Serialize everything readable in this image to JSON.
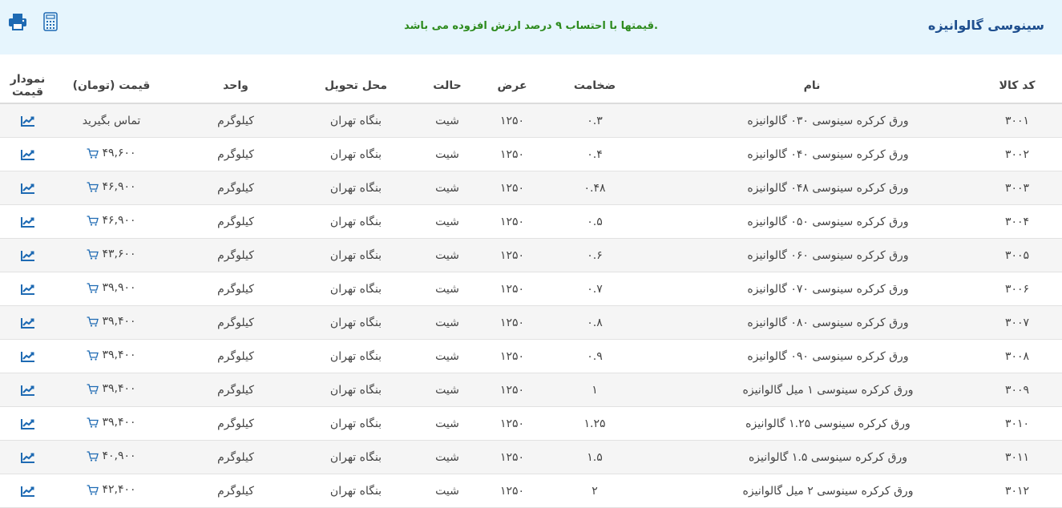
{
  "header": {
    "title": "سینوسی گالوانیزه",
    "vat_notice": "قیمتها با احتساب ۹ درصد ارزش افزوده می باشد.",
    "icons": [
      "print-icon",
      "calculator-icon"
    ]
  },
  "colors": {
    "accent": "#1f4f8f",
    "notice": "#2c8a1c",
    "header_bg": "#e6f5fd",
    "icon": "#1e6ab3"
  },
  "table": {
    "columns": {
      "code": "کد کالا",
      "name": "نام",
      "thickness": "ضخامت",
      "width": "عرض",
      "state": "حالت",
      "place": "محل تحویل",
      "unit": "واحد",
      "price": "قیمت (تومان)",
      "chart": "نمودار قیمت"
    },
    "rows": [
      {
        "code": "۳۰۰۱",
        "name": "ورق کرکره سینوسی ۰۳۰ گالوانیزه",
        "thickness": "۰.۳",
        "width": "۱۲۵۰",
        "state": "شیت",
        "place": "بنگاه تهران",
        "unit": "کیلوگرم",
        "price": "تماس بگیرید",
        "cart": false
      },
      {
        "code": "۳۰۰۲",
        "name": "ورق کرکره سینوسی ۰۴۰ گالوانیزه",
        "thickness": "۰.۴",
        "width": "۱۲۵۰",
        "state": "شیت",
        "place": "بنگاه تهران",
        "unit": "کیلوگرم",
        "price": "۴۹,۶۰۰",
        "cart": true
      },
      {
        "code": "۳۰۰۳",
        "name": "ورق کرکره سینوسی ۰۴۸ گالوانیزه",
        "thickness": "۰.۴۸",
        "width": "۱۲۵۰",
        "state": "شیت",
        "place": "بنگاه تهران",
        "unit": "کیلوگرم",
        "price": "۴۶,۹۰۰",
        "cart": true
      },
      {
        "code": "۳۰۰۴",
        "name": "ورق کرکره سینوسی ۰۵۰ گالوانیزه",
        "thickness": "۰.۵",
        "width": "۱۲۵۰",
        "state": "شیت",
        "place": "بنگاه تهران",
        "unit": "کیلوگرم",
        "price": "۴۶,۹۰۰",
        "cart": true
      },
      {
        "code": "۳۰۰۵",
        "name": "ورق کرکره سینوسی ۰۶۰ گالوانیزه",
        "thickness": "۰.۶",
        "width": "۱۲۵۰",
        "state": "شیت",
        "place": "بنگاه تهران",
        "unit": "کیلوگرم",
        "price": "۴۳,۶۰۰",
        "cart": true
      },
      {
        "code": "۳۰۰۶",
        "name": "ورق کرکره سینوسی ۰۷۰ گالوانیزه",
        "thickness": "۰.۷",
        "width": "۱۲۵۰",
        "state": "شیت",
        "place": "بنگاه تهران",
        "unit": "کیلوگرم",
        "price": "۳۹,۹۰۰",
        "cart": true
      },
      {
        "code": "۳۰۰۷",
        "name": "ورق کرکره سینوسی ۰۸۰ گالوانیزه",
        "thickness": "۰.۸",
        "width": "۱۲۵۰",
        "state": "شیت",
        "place": "بنگاه تهران",
        "unit": "کیلوگرم",
        "price": "۳۹,۴۰۰",
        "cart": true
      },
      {
        "code": "۳۰۰۸",
        "name": "ورق کرکره سینوسی ۰۹۰ گالوانیزه",
        "thickness": "۰.۹",
        "width": "۱۲۵۰",
        "state": "شیت",
        "place": "بنگاه تهران",
        "unit": "کیلوگرم",
        "price": "۳۹,۴۰۰",
        "cart": true
      },
      {
        "code": "۳۰۰۹",
        "name": "ورق کرکره سینوسی ۱ میل گالوانیزه",
        "thickness": "۱",
        "width": "۱۲۵۰",
        "state": "شیت",
        "place": "بنگاه تهران",
        "unit": "کیلوگرم",
        "price": "۳۹,۴۰۰",
        "cart": true
      },
      {
        "code": "۳۰۱۰",
        "name": "ورق کرکره سینوسی ۱.۲۵ گالوانیزه",
        "thickness": "۱.۲۵",
        "width": "۱۲۵۰",
        "state": "شیت",
        "place": "بنگاه تهران",
        "unit": "کیلوگرم",
        "price": "۳۹,۴۰۰",
        "cart": true
      },
      {
        "code": "۳۰۱۱",
        "name": "ورق کرکره سینوسی ۱.۵ گالوانیزه",
        "thickness": "۱.۵",
        "width": "۱۲۵۰",
        "state": "شیت",
        "place": "بنگاه تهران",
        "unit": "کیلوگرم",
        "price": "۴۰,۹۰۰",
        "cart": true
      },
      {
        "code": "۳۰۱۲",
        "name": "ورق کرکره سینوسی ۲ میل گالوانیزه",
        "thickness": "۲",
        "width": "۱۲۵۰",
        "state": "شیت",
        "place": "بنگاه تهران",
        "unit": "کیلوگرم",
        "price": "۴۲,۴۰۰",
        "cart": true
      }
    ]
  }
}
